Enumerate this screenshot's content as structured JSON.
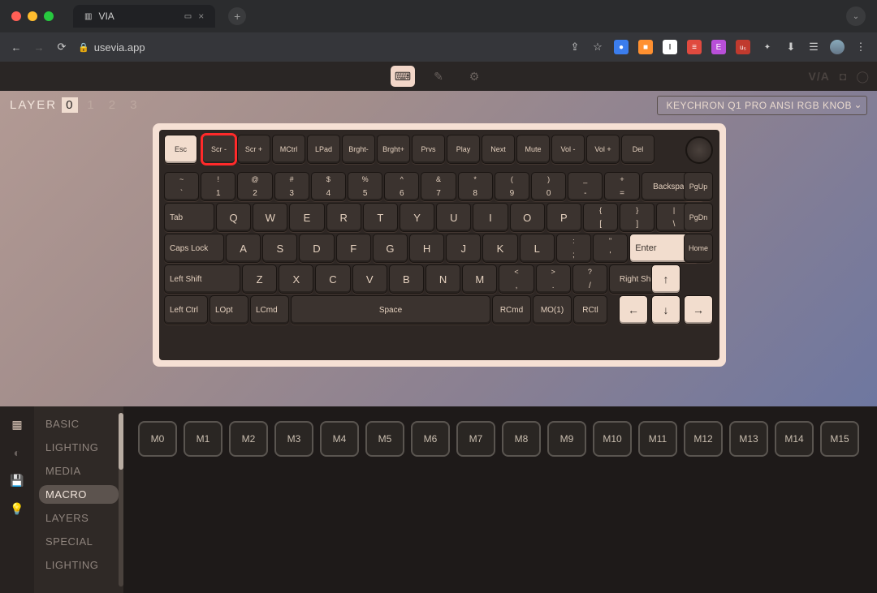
{
  "browser": {
    "tab_title": "VIA",
    "url": "usevia.app",
    "url_lock": "🔒"
  },
  "header": {
    "brand": "V/A"
  },
  "layer": {
    "label": "LAYER",
    "values": [
      "0",
      "1",
      "2",
      "3"
    ],
    "active": 0
  },
  "device": "KEYCHRON Q1 PRO ANSI RGB KNOB",
  "selected_key_index": 1,
  "rows": {
    "fn": [
      "Esc",
      "Scr -",
      "Scr +",
      "MCtrl",
      "LPad",
      "Brght-",
      "Brght+",
      "Prvs",
      "Play",
      "Next",
      "Mute",
      "Vol -",
      "Vol +",
      "Del"
    ],
    "num_top": [
      "~",
      "!",
      "@",
      "#",
      "$",
      "%",
      "^",
      "&",
      "*",
      "(",
      ")",
      "_",
      "+"
    ],
    "num_bot": [
      "`",
      "1",
      "2",
      "3",
      "4",
      "5",
      "6",
      "7",
      "8",
      "9",
      "0",
      "-",
      "="
    ],
    "num_end": "Backspace",
    "q": [
      "Tab",
      "Q",
      "W",
      "E",
      "R",
      "T",
      "Y",
      "U",
      "I",
      "O",
      "P"
    ],
    "q_br": [
      [
        "{",
        "["
      ],
      [
        "}",
        "]"
      ],
      [
        "|",
        "\\"
      ]
    ],
    "a": [
      "Caps Lock",
      "A",
      "S",
      "D",
      "F",
      "G",
      "H",
      "J",
      "K",
      "L"
    ],
    "a_sc": [
      [
        ":",
        ";"
      ],
      [
        "\"",
        "'"
      ]
    ],
    "a_end": "Enter",
    "z": [
      "Left Shift",
      "Z",
      "X",
      "C",
      "V",
      "B",
      "N",
      "M"
    ],
    "z_sc": [
      [
        "<",
        ","
      ],
      [
        ">",
        "."
      ],
      [
        "?",
        "/"
      ]
    ],
    "z_end": "Right Shift",
    "sp": [
      "Left Ctrl",
      "LOpt",
      "LCmd",
      "Space",
      "RCmd",
      "MO(1)",
      "RCtl"
    ],
    "side": [
      "PgUp",
      "PgDn",
      "Home"
    ],
    "arrows": [
      "↑",
      "←",
      "↓",
      "→"
    ]
  },
  "categories": [
    "BASIC",
    "LIGHTING",
    "MEDIA",
    "MACRO",
    "LAYERS",
    "SPECIAL",
    "LIGHTING"
  ],
  "cat_active": 3,
  "macros": [
    "M0",
    "M1",
    "M2",
    "M3",
    "M4",
    "M5",
    "M6",
    "M7",
    "M8",
    "M9",
    "M10",
    "M11",
    "M12",
    "M13",
    "M14",
    "M15"
  ]
}
